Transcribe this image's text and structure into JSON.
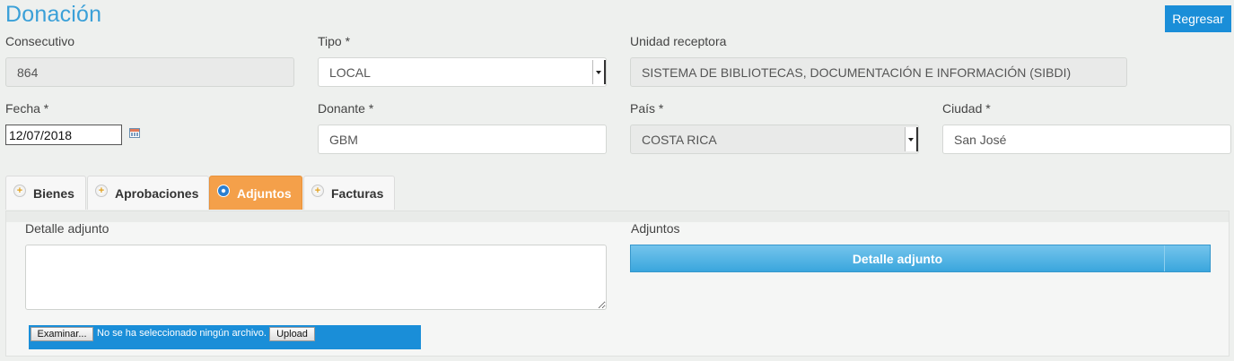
{
  "header": {
    "title": "Donación",
    "back_label": "Regresar"
  },
  "form": {
    "consecutivo": {
      "label": "Consecutivo",
      "value": "864"
    },
    "tipo": {
      "label": "Tipo *",
      "value": "LOCAL"
    },
    "unidad": {
      "label": "Unidad receptora",
      "value": "SISTEMA DE BIBLIOTECAS, DOCUMENTACIÓN E INFORMACIÓN (SIBDI)"
    },
    "fecha": {
      "label": "Fecha *",
      "value": "12/07/2018"
    },
    "donante": {
      "label": "Donante *",
      "value": "GBM"
    },
    "pais": {
      "label": "País *",
      "value": "COSTA RICA"
    },
    "ciudad": {
      "label": "Ciudad *",
      "value": "San José"
    }
  },
  "tabs": [
    {
      "label": "Bienes",
      "icon": "plus-circle-icon"
    },
    {
      "label": "Aprobaciones",
      "icon": "plus-circle-icon"
    },
    {
      "label": "Adjuntos",
      "icon": "minus-circle-icon",
      "active": true
    },
    {
      "label": "Facturas",
      "icon": "plus-circle-icon"
    }
  ],
  "adjuntos": {
    "detalle_label": "Detalle adjunto",
    "browse_label": "Examinar...",
    "no_file_text": "No se ha seleccionado ningún archivo.",
    "upload_label": "Upload",
    "list_label": "Adjuntos",
    "grid_column": "Detalle adjunto"
  },
  "colors": {
    "accent": "#1a8ed8",
    "title": "#3aa0d8",
    "active_tab": "#f4a04a"
  }
}
